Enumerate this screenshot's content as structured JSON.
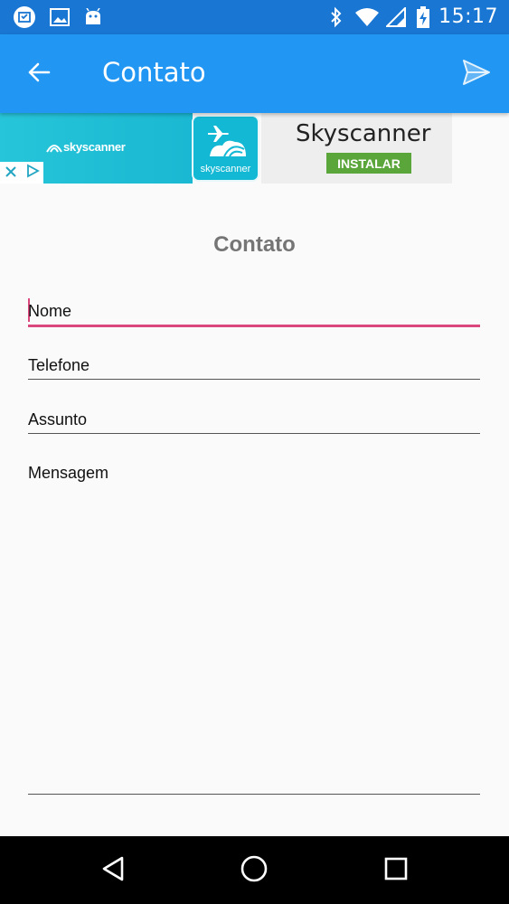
{
  "status_bar": {
    "time": "15:17",
    "left_icons": [
      "calendar-notification-icon",
      "image-notification-icon",
      "android-notification-icon"
    ],
    "right_icons": [
      "bluetooth-icon",
      "wifi-icon",
      "signal-icon",
      "battery-charging-icon"
    ]
  },
  "app_bar": {
    "title": "Contato",
    "back_icon": "arrow-left-icon",
    "send_icon": "send-icon"
  },
  "ad": {
    "brand_small": "skyscanner",
    "app_icon_text": "skyscanner",
    "app_name": "Skyscanner",
    "install_label": "INSTALAR",
    "close_icon": "close-icon",
    "adchoices_icon": "adchoices-icon"
  },
  "form": {
    "title": "Contato",
    "fields": [
      {
        "label": "Nome",
        "focused": true
      },
      {
        "label": "Telefone",
        "focused": false
      },
      {
        "label": "Assunto",
        "focused": false
      },
      {
        "label": "Mensagem",
        "focused": false
      }
    ]
  },
  "nav_bar": {
    "back_icon": "nav-back-icon",
    "home_icon": "nav-home-icon",
    "recents_icon": "nav-recents-icon"
  },
  "colors": {
    "status_bar": "#1976d2",
    "app_bar": "#2196f3",
    "accent": "#d9477c",
    "install_button": "#5aa63a",
    "ad_brand": "#12b8d4"
  }
}
